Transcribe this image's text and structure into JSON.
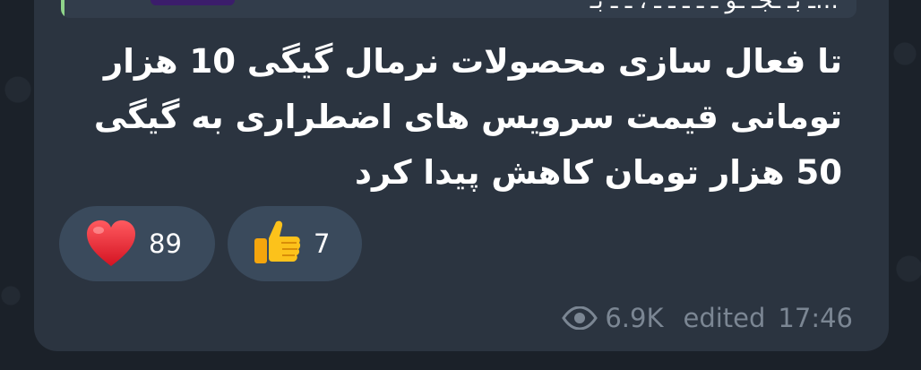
{
  "reply": {
    "text": "…ـ بـ ـجـ ـو ـ ـ ـ ـ ـ ، ـ ـ بـ"
  },
  "message": {
    "text": "تا فعال سازی محصولات نرمال گیگی 10 هزار تومانی قیمت سرویس های اضطراری به گیگی 50 هزار تومان کاهش پیدا کرد"
  },
  "reactions": [
    {
      "icon": "heart-icon",
      "count": "89"
    },
    {
      "icon": "thumbs-up-icon",
      "count": "7"
    }
  ],
  "meta": {
    "views": "6.9K",
    "edited_label": "edited",
    "time": "17:46"
  },
  "colors": {
    "background": "#1b2129",
    "bubble": "#2b3440",
    "reaction_pill": "#3a4a5c",
    "meta_text": "#7b8693",
    "reply_accent": "#8fd48a"
  }
}
